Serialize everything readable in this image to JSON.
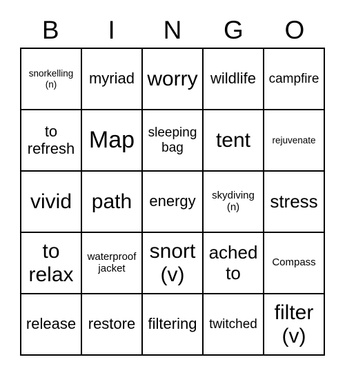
{
  "header": {
    "letters": [
      "B",
      "I",
      "N",
      "G",
      "O"
    ]
  },
  "grid": {
    "rows": [
      [
        {
          "text": "snorkelling (n)",
          "size": "xs"
        },
        {
          "text": "myriad",
          "size": "lg"
        },
        {
          "text": "worry",
          "size": "xxl"
        },
        {
          "text": "wildlife",
          "size": "lg"
        },
        {
          "text": "campfire",
          "size": "md"
        }
      ],
      [
        {
          "text": "to refresh",
          "size": "lg"
        },
        {
          "text": "Map",
          "size": "huge"
        },
        {
          "text": "sleeping bag",
          "size": "md"
        },
        {
          "text": "tent",
          "size": "xxl"
        },
        {
          "text": "rejuvenate",
          "size": "xs"
        }
      ],
      [
        {
          "text": "vivid",
          "size": "xxl"
        },
        {
          "text": "path",
          "size": "xxl"
        },
        {
          "text": "energy",
          "size": "lg"
        },
        {
          "text": "skydiving (n)",
          "size": "sm"
        },
        {
          "text": "stress",
          "size": "xl"
        }
      ],
      [
        {
          "text": "to relax",
          "size": "xxl"
        },
        {
          "text": "waterproof jacket",
          "size": "sm"
        },
        {
          "text": "snort (v)",
          "size": "xxl"
        },
        {
          "text": "ached to",
          "size": "xl"
        },
        {
          "text": "Compass",
          "size": "sm"
        }
      ],
      [
        {
          "text": "release",
          "size": "lg"
        },
        {
          "text": "restore",
          "size": "lg"
        },
        {
          "text": "filtering",
          "size": "lg"
        },
        {
          "text": "twitched",
          "size": "md"
        },
        {
          "text": "filter (v)",
          "size": "xxl"
        }
      ]
    ]
  }
}
